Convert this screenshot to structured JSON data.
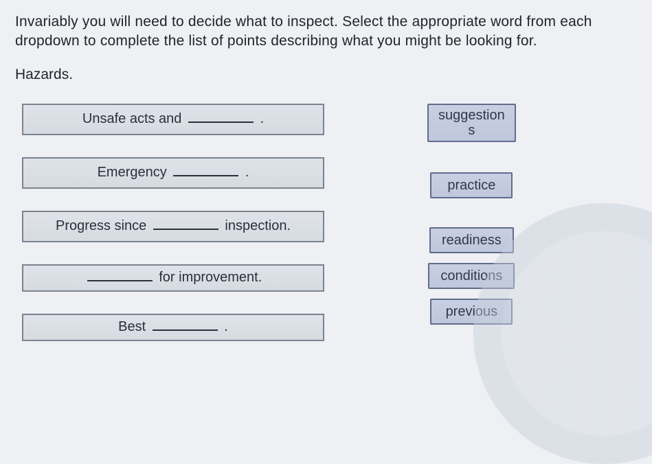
{
  "instruction": "Invariably you will need to decide what to inspect. Select the appropriate word from each dropdown to complete the list of points describing what you might be looking for.",
  "subheading": "Hazards.",
  "slots": [
    {
      "pre": "Unsafe acts and ",
      "post": " ."
    },
    {
      "pre": "Emergency ",
      "post": " ."
    },
    {
      "pre": "Progress since ",
      "post": " inspection."
    },
    {
      "pre": "",
      "post": " for improvement."
    },
    {
      "pre": "Best ",
      "post": " ."
    }
  ],
  "choices": [
    "suggestions",
    "practice",
    "readiness",
    "conditions",
    "previous"
  ]
}
